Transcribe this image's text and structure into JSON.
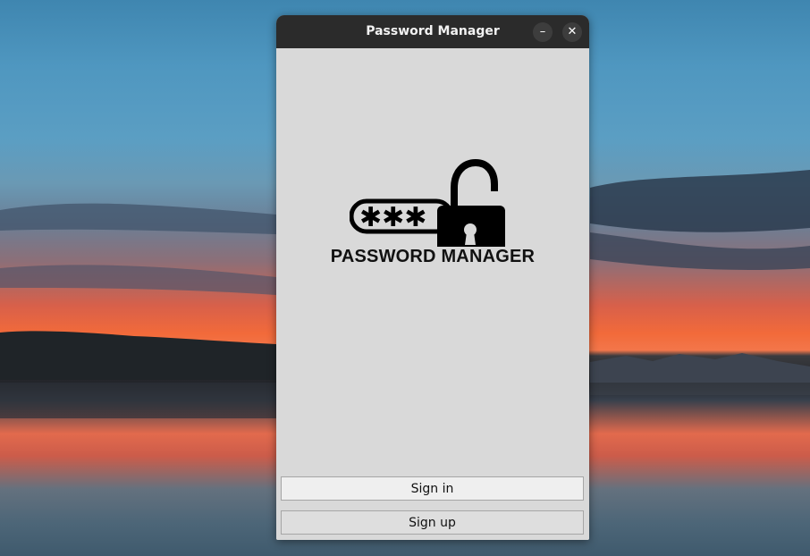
{
  "window": {
    "title": "Password Manager",
    "minimize_glyph": "–",
    "close_glyph": "✕"
  },
  "logo": {
    "icon": "open-padlock-with-password-field",
    "mask_text": "✱✱✱",
    "text": "PASSWORD MANAGER"
  },
  "buttons": {
    "sign_in": "Sign in",
    "sign_up": "Sign up"
  },
  "colors": {
    "titlebar": "#2b2b2b",
    "window_bg": "#d9d9d9",
    "button_bg": "#efefef",
    "logo": "#000000"
  }
}
